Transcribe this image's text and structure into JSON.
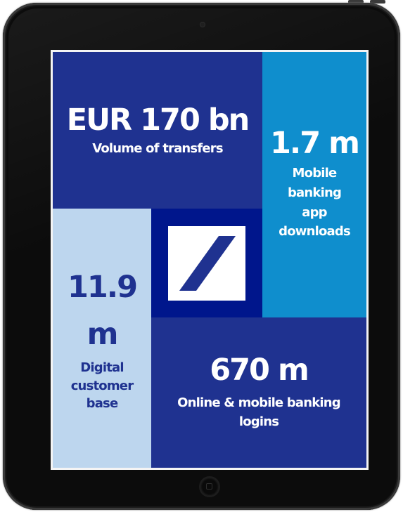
{
  "tiles": {
    "transfers": {
      "value": "EUR 170 bn",
      "label": "Volume of transfers"
    },
    "app_downloads": {
      "value": "1.7 m",
      "label_lines": [
        "Mobile",
        "banking",
        "app",
        "downloads"
      ]
    },
    "customer_base": {
      "value_lines": [
        "11.9",
        "m"
      ],
      "label_lines": [
        "Digital",
        "customer",
        "base"
      ]
    },
    "logins": {
      "value": "670 m",
      "label_lines": [
        "Online & mobile banking",
        "logins"
      ]
    }
  },
  "logo": {
    "icon": "deutsche-bank-slash-logo"
  },
  "device": {
    "home_button_icon": "home-button-icon"
  },
  "colors": {
    "dark_blue": "#1f3290",
    "logo_blue": "#00168c",
    "light_blue": "#0f8ecd",
    "pale_blue": "#bdd6ee",
    "tablet_bezel": "#0c0c0c"
  }
}
